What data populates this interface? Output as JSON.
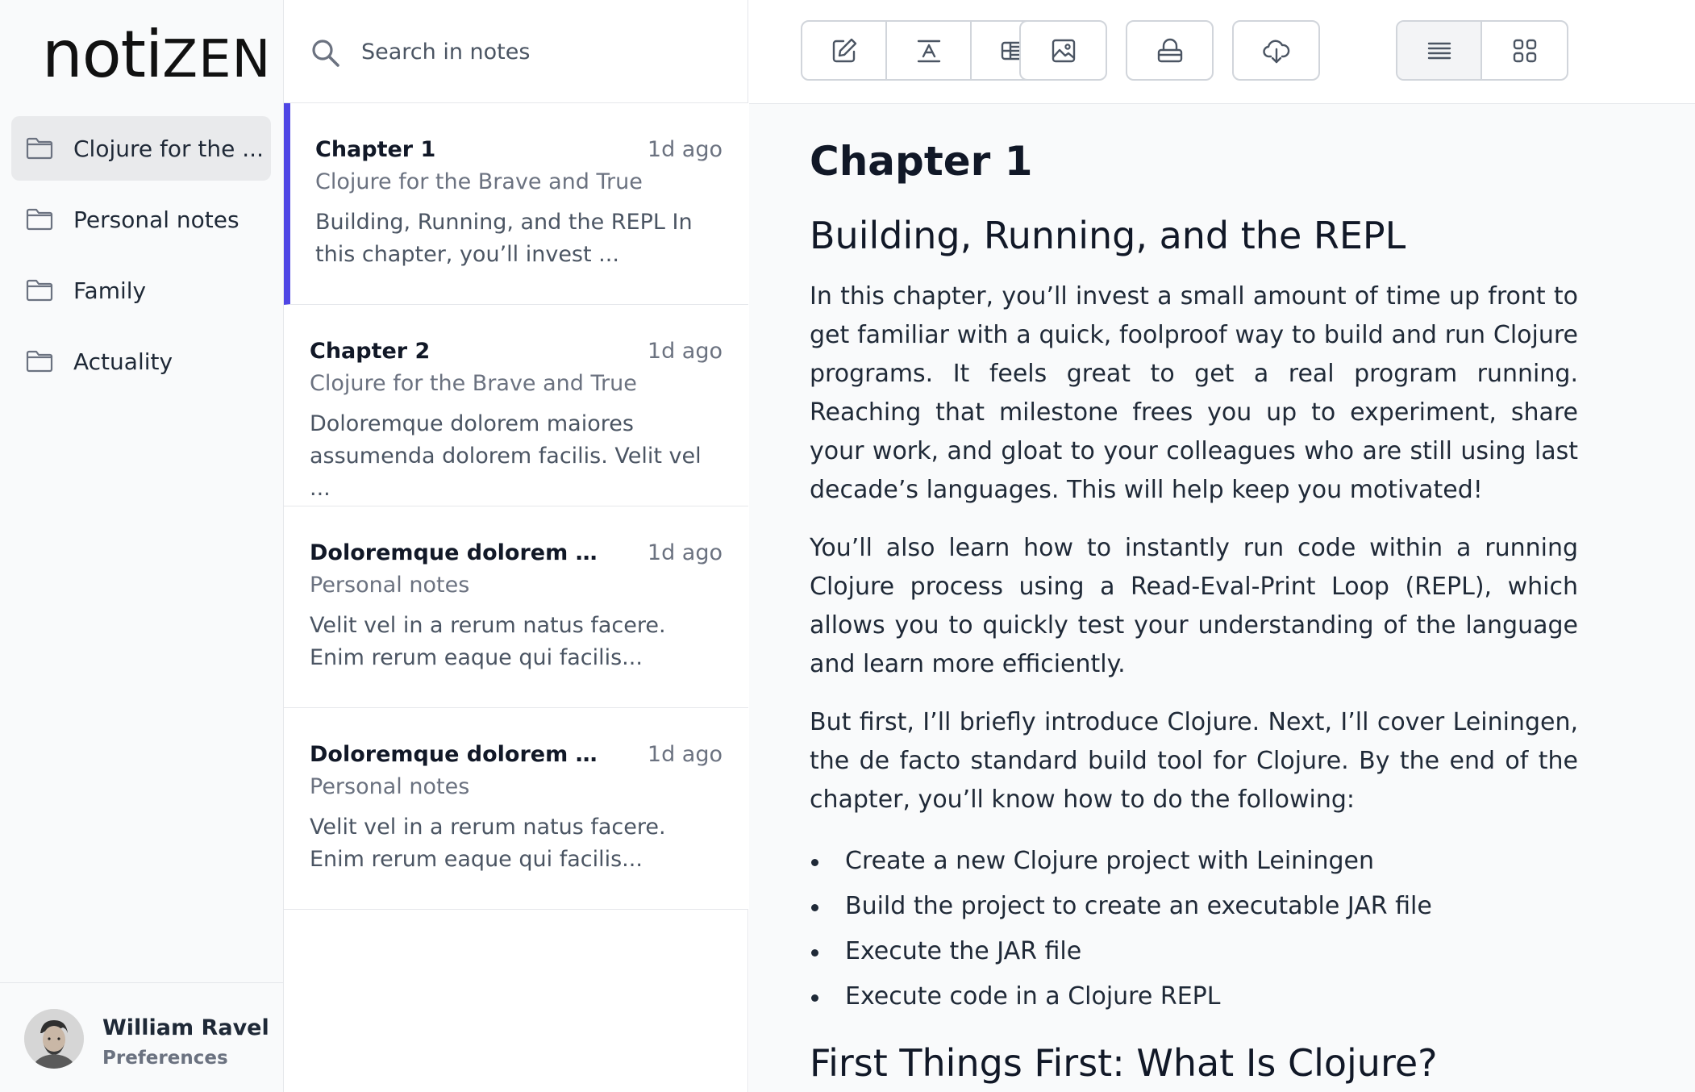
{
  "app": {
    "logo_main": "noti",
    "logo_accent": "ZEN"
  },
  "sidebar": {
    "folders": [
      {
        "label": "Clojure for the ...",
        "active": true
      },
      {
        "label": "Personal notes"
      },
      {
        "label": "Family"
      },
      {
        "label": "Actuality"
      }
    ],
    "user": {
      "name": "William Ravel",
      "prefs_label": "Preferences"
    }
  },
  "notelist": {
    "search_placeholder": "Search in notes",
    "notes": [
      {
        "title": "Chapter 1",
        "time": "1d ago",
        "folder": "Clojure for the Brave and True",
        "excerpt": "Building, Running, and the REPL In this chapter, you’ll invest ..."
      },
      {
        "title": "Chapter 2",
        "time": "1d ago",
        "folder": "Clojure for the Brave and True",
        "excerpt": "Doloremque dolorem maiores assumenda dolorem facilis. Velit vel ..."
      },
      {
        "title": "Doloremque dolorem maiores...",
        "time": "1d ago",
        "folder": "Personal notes",
        "excerpt": "Velit vel in a rerum natus facere. Enim rerum eaque qui facilis..."
      },
      {
        "title": "Doloremque dolorem maiores...",
        "time": "1d ago",
        "folder": "Personal notes",
        "excerpt": "Velit vel in a rerum natus facere. Enim rerum eaque qui facilis..."
      }
    ]
  },
  "toolbar": {
    "groups": [
      [
        "edit-icon",
        "text-format-icon",
        "table-icon"
      ],
      [
        "image-icon"
      ],
      [
        "lock-icon"
      ],
      [
        "download-icon"
      ],
      [
        "list-view-icon",
        "grid-view-icon"
      ]
    ],
    "active_view": "list-view-icon"
  },
  "editor": {
    "title": "Chapter 1",
    "heading": "Building, Running, and the REPL",
    "paragraphs": [
      "In this chapter, you’ll invest a small amount of time up front to get familiar with a quick, foolproof way to build and run Clojure programs. It feels great to get a real program running. Reaching that milestone frees you up to experiment, share your work, and gloat to your colleagues who are still using last decade’s languages. This will help keep you motivated!",
      "You’ll also learn how to instantly run code within a running Clojure process using a Read-Eval-Print Loop (REPL), which allows you to quickly test your understanding of the language and learn more efficiently.",
      "But first, I’ll briefly introduce Clojure. Next, I’ll cover Leiningen, the de facto standard build tool for Clojure. By the end of the chapter, you’ll know how to do the following:"
    ],
    "list": [
      "Create a new Clojure project with Leiningen",
      "Build the project to create an executable JAR file",
      "Execute the JAR file",
      "Execute code in a Clojure REPL"
    ],
    "next_heading": "First Things First: What Is Clojure?"
  }
}
